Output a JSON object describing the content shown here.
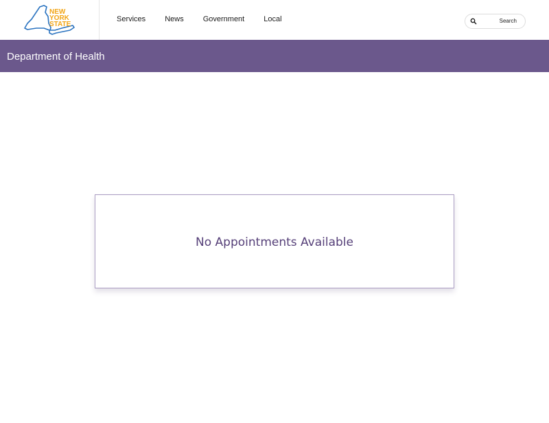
{
  "header": {
    "logo": {
      "text_lines": [
        "NEW",
        "YORK",
        "STATE"
      ],
      "icon": "new-york-state-outline-icon"
    },
    "nav": [
      {
        "label": "Services"
      },
      {
        "label": "News"
      },
      {
        "label": "Government"
      },
      {
        "label": "Local"
      }
    ],
    "search": {
      "label": "Search",
      "icon": "search-icon"
    }
  },
  "agency_bar": {
    "title": "Department of Health"
  },
  "main": {
    "message": "No Appointments Available"
  },
  "colors": {
    "agency_bar": "#6b588c",
    "message_text": "#553f78",
    "card_border": "#a99bc1",
    "logo_text": "#f2a516",
    "logo_outline": "#2a73c0"
  }
}
